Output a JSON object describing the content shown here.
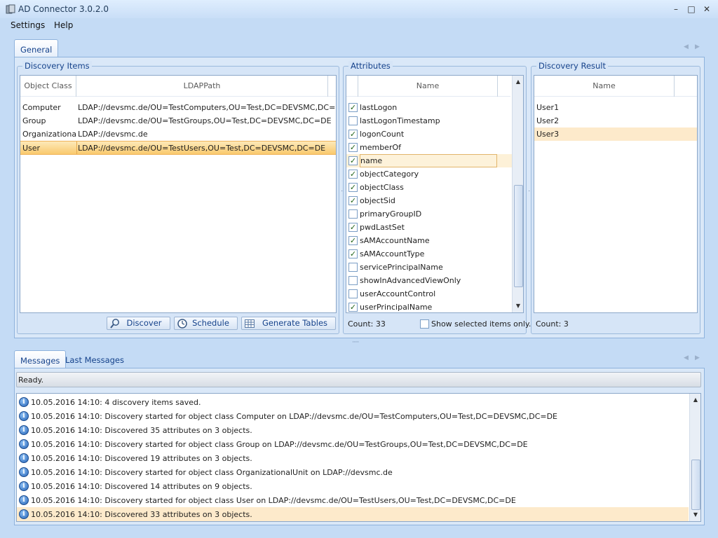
{
  "window": {
    "title": "AD Connector 3.0.2.0",
    "minimize": "–",
    "maximize": "□",
    "close": "✕"
  },
  "menu": [
    "Settings",
    "Help"
  ],
  "top_tabs": [
    "General"
  ],
  "discovery_items": {
    "title": "Discovery Items",
    "columns": [
      "Object Class",
      "LDAPPath"
    ],
    "rows": [
      {
        "class": "Computer",
        "path": "LDAP://devsmc.de/OU=TestComputers,OU=Test,DC=DEVSMC,DC=DE"
      },
      {
        "class": "Group",
        "path": "LDAP://devsmc.de/OU=TestGroups,OU=Test,DC=DEVSMC,DC=DE"
      },
      {
        "class": "Organizational",
        "path": "LDAP://devsmc.de"
      },
      {
        "class": "User",
        "path": "LDAP://devsmc.de/OU=TestUsers,OU=Test,DC=DEVSMC,DC=DE"
      }
    ],
    "buttons": {
      "discover": "Discover",
      "schedule": "Schedule",
      "generate": "Generate Tables"
    }
  },
  "attributes": {
    "title": "Attributes",
    "column": "Name",
    "items": [
      {
        "name": "lastLogon",
        "checked": true
      },
      {
        "name": "lastLogonTimestamp",
        "checked": false
      },
      {
        "name": "logonCount",
        "checked": true
      },
      {
        "name": "memberOf",
        "checked": true
      },
      {
        "name": "name",
        "checked": true
      },
      {
        "name": "objectCategory",
        "checked": true
      },
      {
        "name": "objectClass",
        "checked": true
      },
      {
        "name": "objectSid",
        "checked": true
      },
      {
        "name": "primaryGroupID",
        "checked": false
      },
      {
        "name": "pwdLastSet",
        "checked": true
      },
      {
        "name": "sAMAccountName",
        "checked": true
      },
      {
        "name": "sAMAccountType",
        "checked": true
      },
      {
        "name": "servicePrincipalName",
        "checked": false
      },
      {
        "name": "showInAdvancedViewOnly",
        "checked": false
      },
      {
        "name": "userAccountControl",
        "checked": false
      },
      {
        "name": "userPrincipalName",
        "checked": true
      }
    ],
    "count": "Count: 33",
    "show_selected_label": "Show selected items only."
  },
  "discovery_result": {
    "title": "Discovery Result",
    "column": "Name",
    "items": [
      "User1",
      "User2",
      "User3"
    ],
    "count": "Count: 3"
  },
  "bottom_tabs": [
    "Messages",
    "Last Messages"
  ],
  "status": "Ready.",
  "messages": [
    "10.05.2016 14:10: 4 discovery items saved.",
    "10.05.2016 14:10: Discovery started for object class Computer on LDAP://devsmc.de/OU=TestComputers,OU=Test,DC=DEVSMC,DC=DE",
    "10.05.2016 14:10: Discovered 35 attributes on 3 objects.",
    "10.05.2016 14:10: Discovery started for object class Group on LDAP://devsmc.de/OU=TestGroups,OU=Test,DC=DEVSMC,DC=DE",
    "10.05.2016 14:10: Discovered 19 attributes on 3 objects.",
    "10.05.2016 14:10: Discovery started for object class OrganizationalUnit on LDAP://devsmc.de",
    "10.05.2016 14:10: Discovered 14 attributes on 9 objects.",
    "10.05.2016 14:10: Discovery started for object class User on LDAP://devsmc.de/OU=TestUsers,OU=Test,DC=DEVSMC,DC=DE",
    "10.05.2016 14:10: Discovered 33 attributes on 3 objects."
  ],
  "icons": {
    "info": "info-icon",
    "discover": "magnifier-icon",
    "schedule": "clock-icon",
    "generate": "table-icon"
  }
}
